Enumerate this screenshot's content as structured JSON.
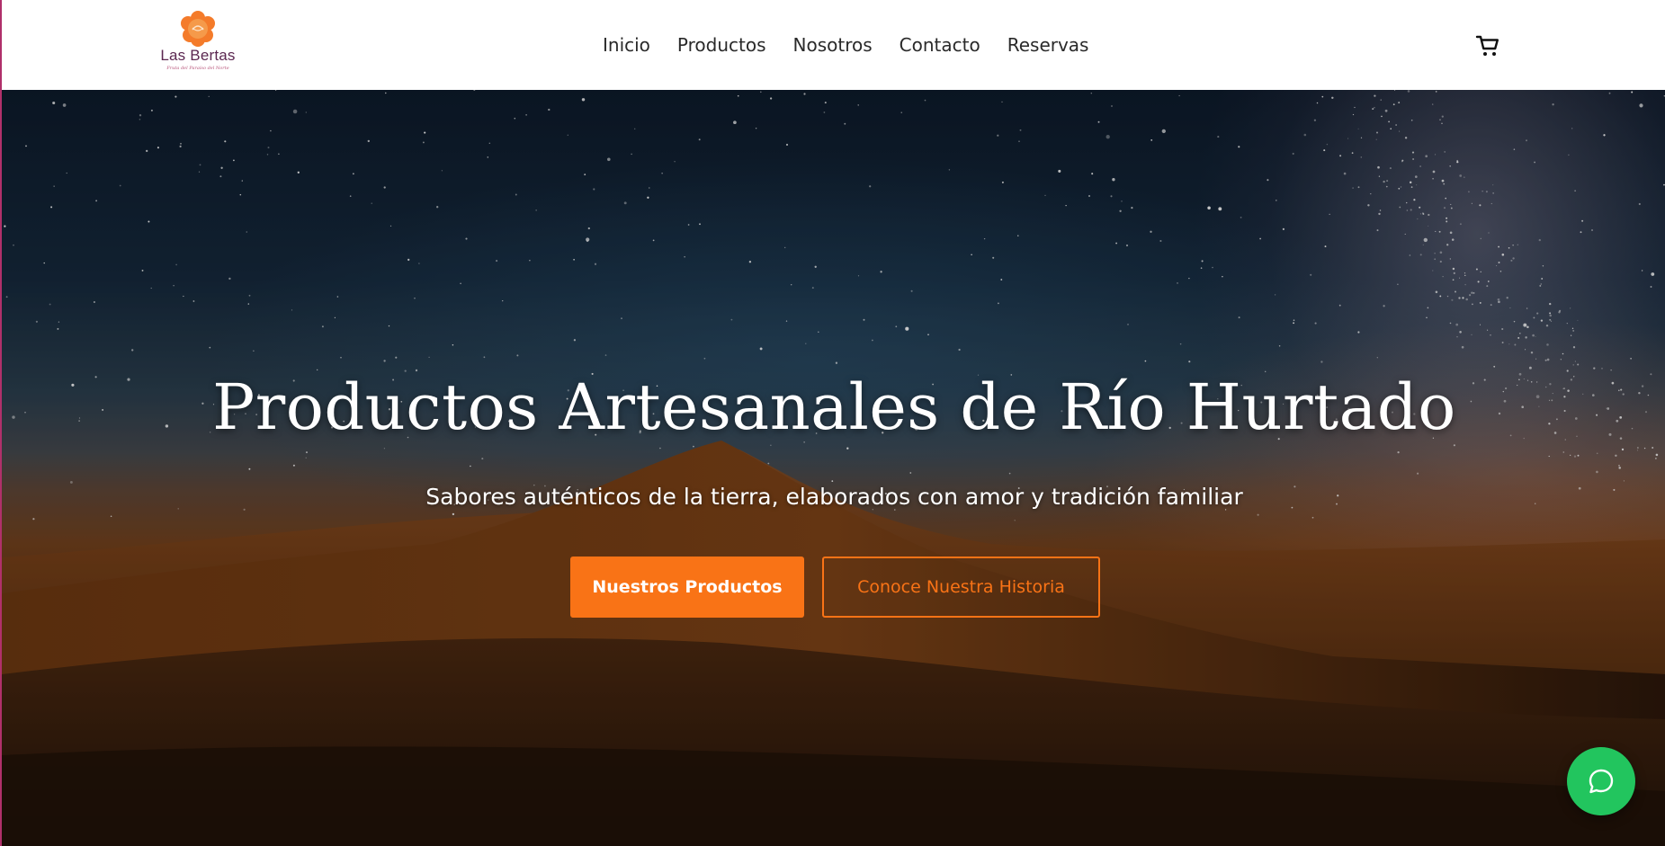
{
  "header": {
    "logo": {
      "name": "Las Bertas",
      "tagline": "Fruta del Paraíso del Norte"
    },
    "nav": [
      {
        "label": "Inicio"
      },
      {
        "label": "Productos"
      },
      {
        "label": "Nosotros"
      },
      {
        "label": "Contacto"
      },
      {
        "label": "Reservas"
      }
    ],
    "cart_icon": "shopping-cart-icon"
  },
  "hero": {
    "title": "Productos Artesanales de Río Hurtado",
    "subtitle": "Sabores auténticos de la tierra, elaborados con amor y tradición familiar",
    "primary_button": "Nuestros Productos",
    "secondary_button": "Conoce Nuestra Historia"
  },
  "chat_button": {
    "icon": "chat-bubble-icon"
  },
  "colors": {
    "accent": "#f97316",
    "chat": "#22c55e",
    "logo_text": "#5b2750"
  }
}
